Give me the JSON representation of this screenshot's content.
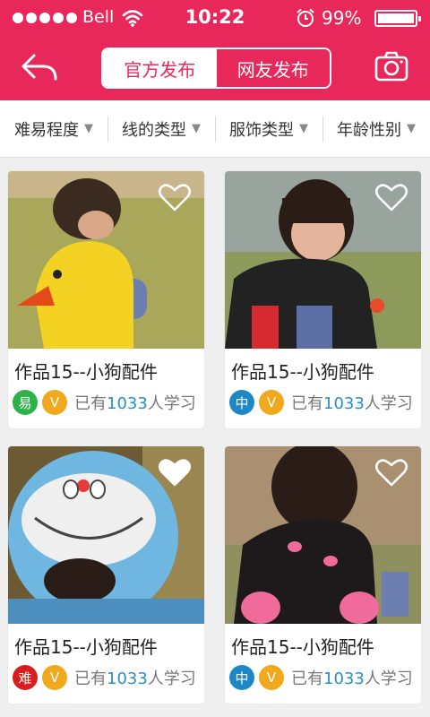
{
  "status_bar": {
    "carrier": "Bell",
    "time": "10:22",
    "battery": "99%",
    "icons": [
      "signal-dots-icon",
      "wifi-icon",
      "alarm-icon",
      "battery-icon"
    ]
  },
  "header": {
    "back_icon": "back-arrow-icon",
    "tabs": [
      {
        "label": "官方发布",
        "active": true
      },
      {
        "label": "网友发布",
        "active": false
      }
    ],
    "camera_icon": "camera-icon"
  },
  "filters": [
    {
      "label": "难易程度"
    },
    {
      "label": "线的类型"
    },
    {
      "label": "服饰类型"
    },
    {
      "label": "年龄性别"
    }
  ],
  "cards": [
    {
      "title": "作品15--小狗配件",
      "level": "易",
      "level_color": "#2db24a",
      "vip": "V",
      "learners_prefix": "已有",
      "learners_count": "1033",
      "learners_suffix": "人学习",
      "favorited": false
    },
    {
      "title": "作品15--小狗配件",
      "level": "中",
      "level_color": "#1e88c7",
      "vip": "V",
      "learners_prefix": "已有",
      "learners_count": "1033",
      "learners_suffix": "人学习",
      "favorited": false
    },
    {
      "title": "作品15--小狗配件",
      "level": "难",
      "level_color": "#d81e1e",
      "vip": "V",
      "learners_prefix": "已有",
      "learners_count": "1033",
      "learners_suffix": "人学习",
      "favorited": true
    },
    {
      "title": "作品15--小狗配件",
      "level": "中",
      "level_color": "#1e88c7",
      "vip": "V",
      "learners_prefix": "已有",
      "learners_count": "1033",
      "learners_suffix": "人学习",
      "favorited": false
    }
  ],
  "colors": {
    "accent": "#e8285a",
    "link": "#2a8fc4",
    "vip": "#f0a81c"
  }
}
